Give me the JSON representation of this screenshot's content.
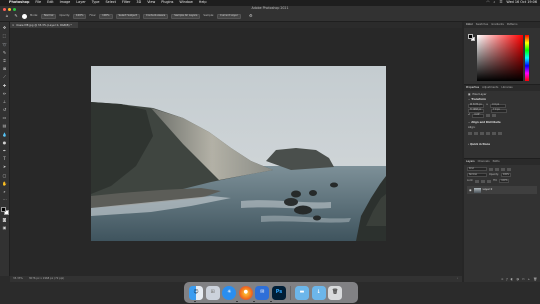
{
  "menubar": {
    "apple_icon": "apple-icon",
    "app_name": "Photoshop",
    "menus": [
      "File",
      "Edit",
      "Image",
      "Layer",
      "Type",
      "Select",
      "Filter",
      "3D",
      "View",
      "Plugins",
      "Window",
      "Help"
    ],
    "clock": "Wed 16 Oct 19:06"
  },
  "window": {
    "title": "Adobe Photoshop 2021"
  },
  "options_bar": {
    "mode_label": "Mode:",
    "mode_value": "Normal",
    "opacity_label": "Opacity:",
    "opacity_value": "100%",
    "flow_label": "Flow:",
    "flow_value": "100%",
    "sample_label": "Sample:",
    "sample_value": "Current Layer",
    "buttons": [
      "Select Subject",
      "Content-Aware",
      "Sample All Layers"
    ]
  },
  "document": {
    "tab_label": "Ossie ME.jpg @ 33.3% (Layer 0, RGB/8) *",
    "zoom": "33.33%",
    "doc_info": "3076 px x 1968 px (72 ppi)"
  },
  "panels": {
    "color_tabs": [
      "Color",
      "Swatches",
      "Gradients",
      "Patterns"
    ],
    "properties_tabs": [
      "Properties",
      "Adjustments",
      "Libraries"
    ],
    "pixel_layer": "Pixel Layer",
    "transform_title": "Transform",
    "w_value": "W 3076 px",
    "h_value": "H 1968 px",
    "x_value": "X 0 px",
    "y_value": "Y 0 px",
    "angle_value": "0.00°",
    "align_title": "Align and Distribute",
    "align_label": "Align:",
    "quick_actions": "Quick Actions",
    "layers_tabs": [
      "Layers",
      "Channels",
      "Paths"
    ],
    "kind_value": "Kind",
    "blend_value": "Normal",
    "opacity_label": "Opacity:",
    "opacity_value": "100%",
    "lock_label": "Lock:",
    "fill_label": "Fill:",
    "fill_value": "100%",
    "layer_name": "Layer 0"
  },
  "dock": {
    "apps": [
      "finder-icon",
      "safari-icon",
      "firefox-icon",
      "mail-icon",
      "photoshop-icon",
      "folder-icon",
      "downloads-icon",
      "trash-icon"
    ]
  }
}
